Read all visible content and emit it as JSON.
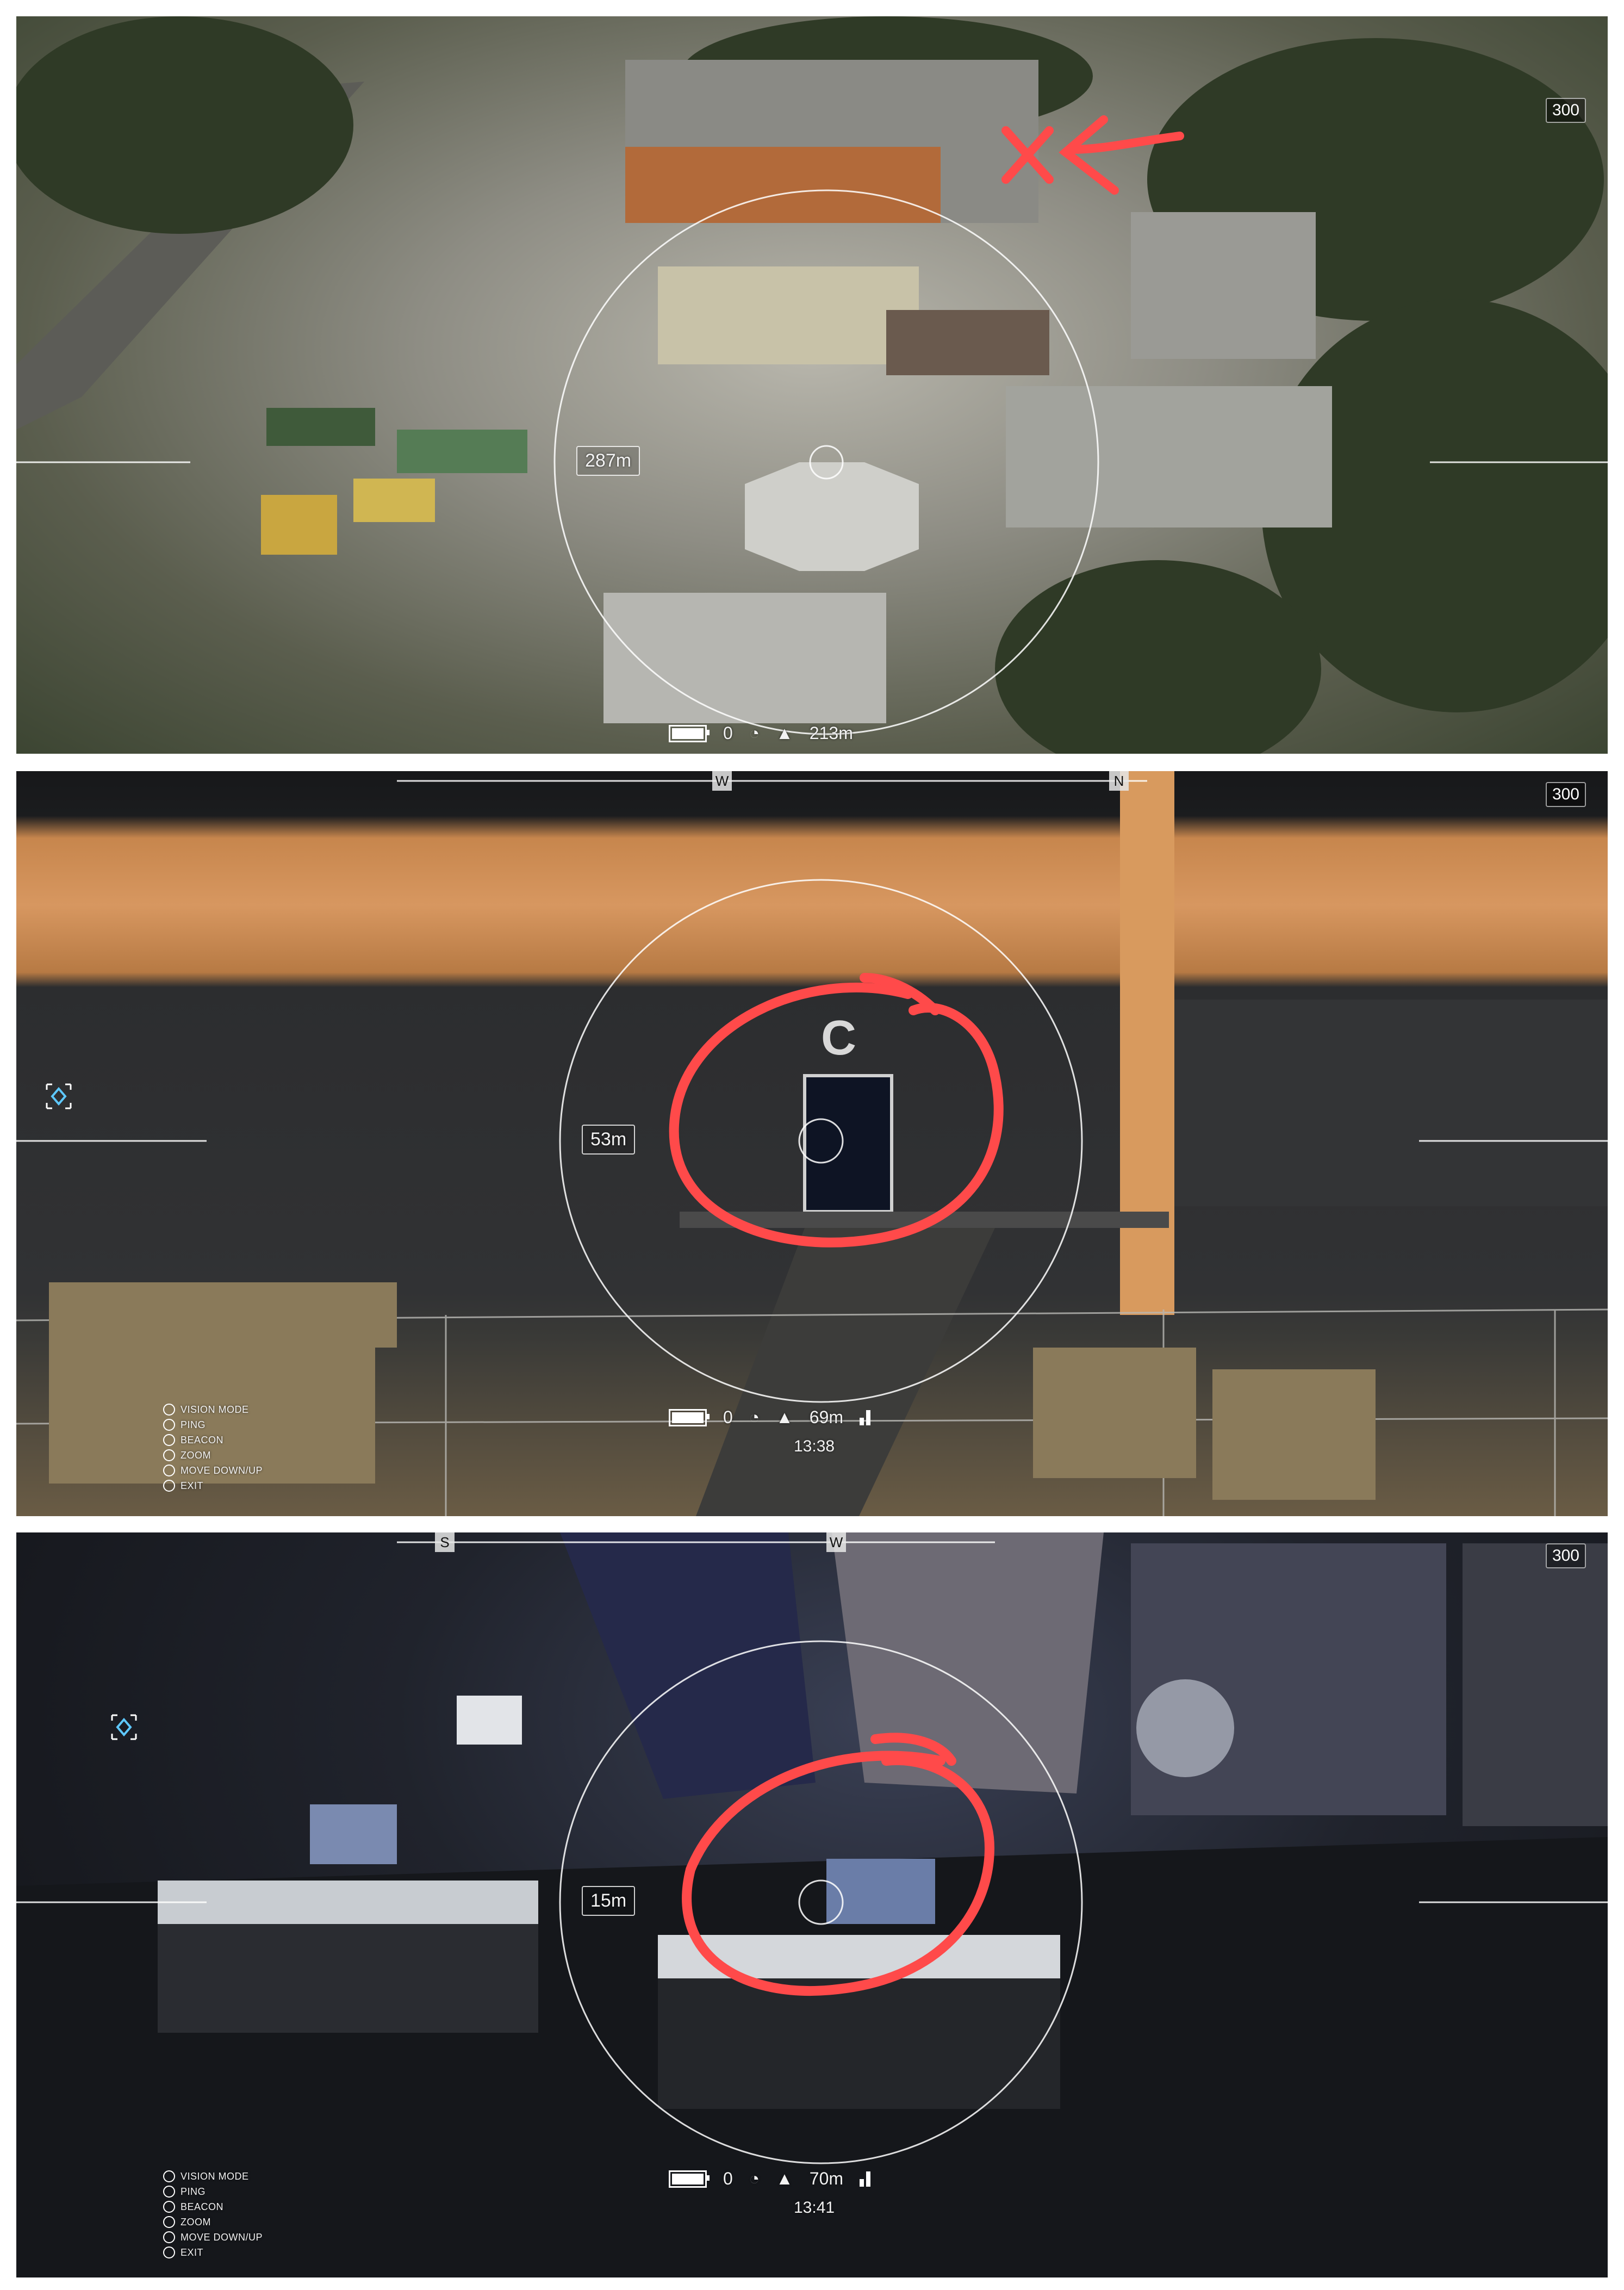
{
  "panels": [
    {
      "ammo": "300",
      "distance": "287m",
      "status": {
        "speed": "0",
        "altitude": "213m",
        "battery_level": 1.0
      },
      "overlay": {
        "marker": "cross-and-arrow",
        "color": "#ff4a4a"
      }
    },
    {
      "ammo": "300",
      "compass": [
        "W",
        "N"
      ],
      "distance": "53m",
      "objective_letter": "C",
      "status": {
        "speed": "0",
        "altitude": "69m",
        "timer": "13:38",
        "battery_level": 1.0
      },
      "controls": [
        "VISION MODE",
        "PING",
        "BEACON",
        "ZOOM",
        "MOVE DOWN/UP",
        "EXIT"
      ],
      "overlay": {
        "marker": "circle",
        "color": "#ff4a4a"
      }
    },
    {
      "ammo": "300",
      "compass": [
        "S",
        "W"
      ],
      "distance": "15m",
      "status": {
        "speed": "0",
        "altitude": "70m",
        "timer": "13:41",
        "battery_level": 1.0
      },
      "controls": [
        "VISION MODE",
        "PING",
        "BEACON",
        "ZOOM",
        "MOVE DOWN/UP",
        "EXIT"
      ],
      "overlay": {
        "marker": "circle",
        "color": "#ff4a4a"
      }
    }
  ],
  "icons": {
    "speed": "speedometer-icon",
    "altitude": "mountain-icon",
    "battery": "battery-icon",
    "signal": "signal-icon",
    "ping_marker": "diamond-marker-icon"
  }
}
